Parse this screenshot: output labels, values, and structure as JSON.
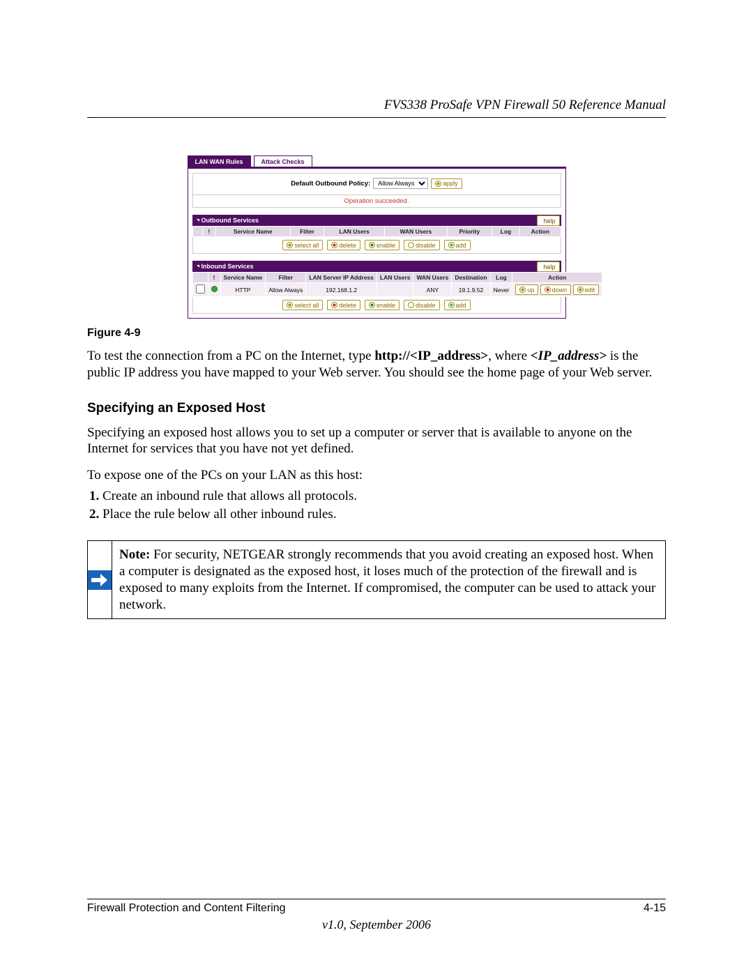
{
  "doc": {
    "header": "FVS338 ProSafe VPN Firewall 50 Reference Manual",
    "figure_label": "Figure 4-9",
    "section_heading": "Specifying an Exposed Host",
    "paragraph_1_pre": "To test the connection from a PC on the Internet, type ",
    "paragraph_1_bold_url": "http://<IP_address>",
    "paragraph_1_mid": ", where ",
    "paragraph_1_bold_ip": "<IP_address>",
    "paragraph_1_post": " is the public IP address you have mapped to your Web server. You should see the home page of your Web server.",
    "paragraph_2": "Specifying an exposed host allows you to set up a computer or server that is available to anyone on the Internet for services that you have not yet defined.",
    "paragraph_3": "To expose one of the PCs on your LAN as this host:",
    "steps": [
      "Create an inbound rule that allows all protocols.",
      "Place the rule below all other inbound rules."
    ],
    "note_label": "Note:",
    "note_body": " For security, NETGEAR strongly recommends that you avoid creating an exposed host. When a computer is designated as the exposed host, it loses much of the protection of the firewall and is exposed to many exploits from the Internet. If compromised, the computer can be used to attack your network.",
    "footer_left": "Firewall Protection and Content Filtering",
    "footer_right": "4-15",
    "footer_version": "v1.0, September 2006"
  },
  "ui": {
    "tabs": {
      "lan_wan_rules": "LAN WAN Rules",
      "attack_checks": "Attack Checks"
    },
    "policy": {
      "label": "Default Outbound Policy:",
      "selected": "Allow Always",
      "apply": "apply"
    },
    "status_message": "Operation succeeded.",
    "buttons": {
      "select_all": "select all",
      "delete": "delete",
      "enable": "enable",
      "disable": "disable",
      "add": "add",
      "help": "help",
      "up": "up",
      "down": "down",
      "edit": "edit"
    },
    "outbound": {
      "title": "Outbound Services",
      "headers": [
        "!",
        "Service Name",
        "Filter",
        "LAN Users",
        "WAN Users",
        "Priority",
        "Log",
        "Action"
      ]
    },
    "inbound": {
      "title": "Inbound Services",
      "headers": [
        "!",
        "Service Name",
        "Filter",
        "LAN Server IP Address",
        "LAN Users",
        "WAN Users",
        "Destination",
        "Log",
        "Action"
      ],
      "row": {
        "service_name": "HTTP",
        "filter": "Allow Always",
        "lan_server_ip": "192.168.1.2",
        "lan_users": "",
        "wan_users": "ANY",
        "destination": "19.1.9.52",
        "log": "Never"
      }
    }
  }
}
